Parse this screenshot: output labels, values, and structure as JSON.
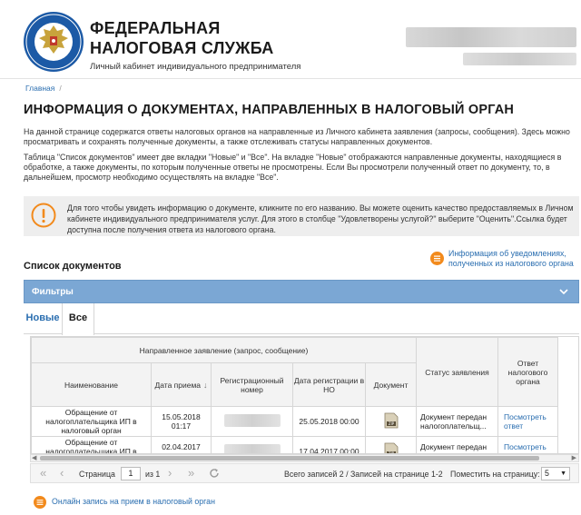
{
  "header": {
    "org_line1": "ФЕДЕРАЛЬНАЯ",
    "org_line2": "НАЛОГОВАЯ СЛУЖБА",
    "org_sub": "Личный кабинет индивидуального предпринимателя"
  },
  "breadcrumb": {
    "home": "Главная",
    "separator": "/"
  },
  "page_title": "ИНФОРМАЦИЯ О ДОКУМЕНТАХ, НАПРАВЛЕННЫХ В НАЛОГОВЫЙ ОРГАН",
  "intro": {
    "p1": "На данной странице содержатся ответы налоговых органов на направленные из Личного кабинета заявления (запросы, сообщения). Здесь можно просматривать и сохранять полученные документы, а также отслеживать статусы направленных документов.",
    "p2": "Таблица \"Список документов\" имеет две вкладки \"Новые\" и \"Все\". На вкладке \"Новые\" отображаются направленные документы, находящиеся в обработке, а также документы, по которым полученные ответы не просмотрены. Если Вы просмотрели полученный ответ по документу, то, в дальнейшем, просмотр необходимо осуществлять на вкладке \"Все\"."
  },
  "notice": {
    "text": "Для того чтобы увидеть информацию о документе, кликните по его названию. Вы можете оценить качество предоставляемых в Личном кабинете индивидуального предпринимателя услуг. Для этого в столбце \"Удовлетворены услугой?\" выберите \"Оценить\".Ссылка будет доступна после получения ответа из налогового органа."
  },
  "documents": {
    "heading": "Список документов",
    "info_link": "Информация об уведомлениях, полученных из налогового органа",
    "filters_label": "Фильтры",
    "tabs": [
      {
        "label": "Новые"
      },
      {
        "label": "Все"
      }
    ],
    "table": {
      "group_header": "Направленное заявление (запрос, сообщение)",
      "col_name": "Наименование",
      "col_date": "Дата приема",
      "col_reg": "Регистрационный номер",
      "col_regdate": "Дата регистрации в НО",
      "col_doc": "Документ",
      "col_status": "Статус заявления",
      "col_resp": "Ответ налогового органа",
      "rows": [
        {
          "name": "Обращение от налогоплательщика ИП в налоговый орган",
          "date": "15.05.2018 01:17",
          "regdate": "25.05.2018 00:00",
          "status": "Документ передан налогоплательщ...",
          "resp": "Посмотреть ответ"
        },
        {
          "name": "Обращение от налогоплательщика ИП в налоговый орган",
          "date": "02.04.2017 23:51",
          "regdate": "17.04.2017 00:00",
          "status": "Документ передан налогоплательщ...",
          "resp": "Посмотреть ответ"
        }
      ]
    },
    "pager": {
      "page_label": "Страница",
      "page_value": "1",
      "of_label": "из 1",
      "summary": "Всего записей 2 / Записей на странице 1-2",
      "per_page_label": "Поместить на страницу:",
      "per_page_value": "5"
    }
  },
  "bottom_link": "Онлайн запись на прием в налоговый орган",
  "colors": {
    "link": "#2a6eb0",
    "filters_bar": "#7ba7d4",
    "accent_orange": "#f28a1c"
  }
}
